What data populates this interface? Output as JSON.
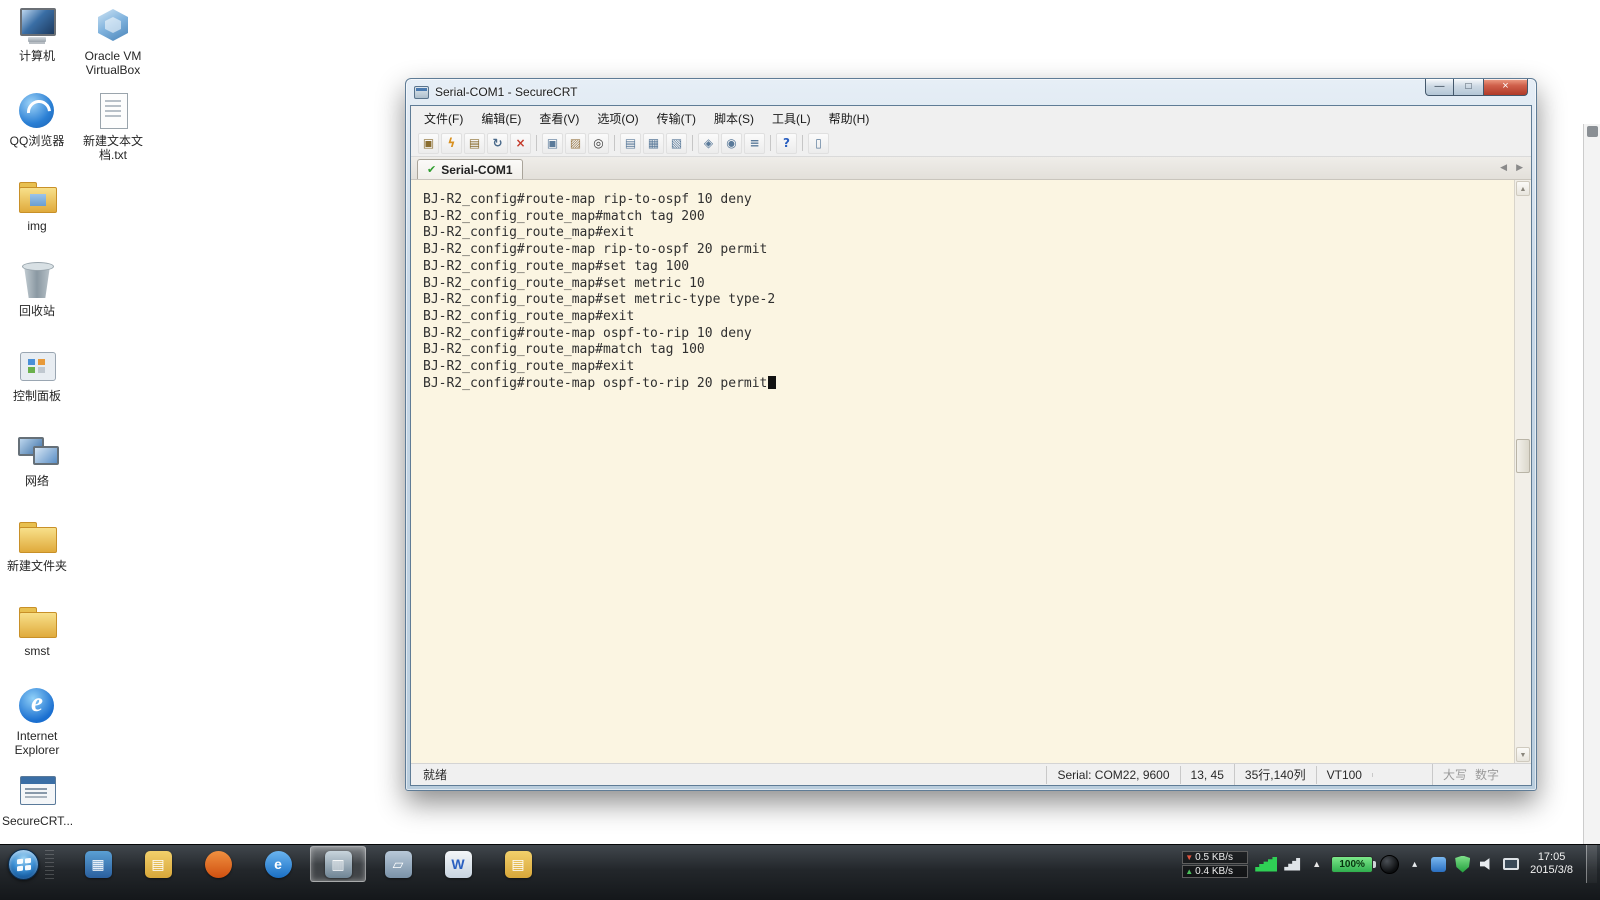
{
  "desktop": {
    "icons_col1": [
      {
        "name": "my-computer",
        "label": "计算机",
        "type": "computer"
      },
      {
        "name": "qq-browser",
        "label": "QQ浏览器",
        "type": "qq"
      },
      {
        "name": "img-folder",
        "label": "img",
        "type": "folder-img"
      },
      {
        "name": "recycle-bin",
        "label": "回收站",
        "type": "recycle"
      },
      {
        "name": "control-panel",
        "label": "控制面板",
        "type": "panel"
      },
      {
        "name": "network",
        "label": "网络",
        "type": "network"
      },
      {
        "name": "new-folder",
        "label": "新建文件夹",
        "type": "folder"
      },
      {
        "name": "smst-folder",
        "label": "smst",
        "type": "folder"
      },
      {
        "name": "internet-explorer",
        "label": "Internet Explorer",
        "type": "ie"
      },
      {
        "name": "securecrt-shortcut",
        "label": "SecureCRT...",
        "type": "crt"
      }
    ],
    "icons_col2": [
      {
        "name": "virtualbox",
        "label": "Oracle VM VirtualBox",
        "type": "vbox"
      },
      {
        "name": "new-text-file",
        "label": "新建文本文档.txt",
        "type": "txt"
      }
    ]
  },
  "window": {
    "title": "Serial-COM1 - SecureCRT",
    "controls": {
      "minimize": "—",
      "maximize": "□",
      "close": "×"
    },
    "menu": [
      "文件(F)",
      "编辑(E)",
      "查看(V)",
      "选项(O)",
      "传输(T)",
      "脚本(S)",
      "工具(L)",
      "帮助(H)"
    ],
    "toolbar": [
      {
        "name": "connect-icon",
        "glyph": "▣",
        "color": "#8a6d2f"
      },
      {
        "name": "quick-connect-icon",
        "glyph": "ϟ",
        "color": "#d89020"
      },
      {
        "name": "connect-in-tab-icon",
        "glyph": "▤",
        "color": "#8a6d2f"
      },
      {
        "name": "reconnect-icon",
        "glyph": "↻",
        "color": "#4a6a8a"
      },
      {
        "name": "disconnect-icon",
        "glyph": "×",
        "color": "#c43a2a"
      },
      {
        "sep": true
      },
      {
        "name": "copy-icon",
        "glyph": "▣",
        "color": "#5a7a9a"
      },
      {
        "name": "paste-icon",
        "glyph": "▨",
        "color": "#9a7a4a"
      },
      {
        "name": "find-icon",
        "glyph": "◎",
        "color": "#3a3a3a"
      },
      {
        "sep": true
      },
      {
        "name": "log-session-icon",
        "glyph": "▤",
        "color": "#5a7a9a"
      },
      {
        "name": "print-icon",
        "glyph": "▦",
        "color": "#5a7a9a"
      },
      {
        "name": "print-preview-icon",
        "glyph": "▧",
        "color": "#5a7a9a"
      },
      {
        "sep": true
      },
      {
        "name": "session-options-icon",
        "glyph": "◈",
        "color": "#5a7a9a"
      },
      {
        "name": "global-options-icon",
        "glyph": "◉",
        "color": "#5a7a9a"
      },
      {
        "name": "keymap-icon",
        "glyph": "≡",
        "color": "#5a7a9a"
      },
      {
        "sep": true
      },
      {
        "name": "help-icon",
        "glyph": "?",
        "color": "#2a5fc0"
      },
      {
        "sep": true
      },
      {
        "name": "properties-icon",
        "glyph": "▯",
        "color": "#5a7a9a"
      }
    ],
    "tab": {
      "check": "✔",
      "label": "Serial-COM1"
    },
    "tab_nav": {
      "left": "◀",
      "right": "▶"
    },
    "terminal": {
      "lines": [
        "BJ-R2_config#route-map rip-to-ospf 10 deny",
        "BJ-R2_config_route_map#match tag 200",
        "BJ-R2_config_route_map#exit",
        "BJ-R2_config#route-map rip-to-ospf 20 permit",
        "BJ-R2_config_route_map#set tag 100",
        "BJ-R2_config_route_map#set metric 10",
        "BJ-R2_config_route_map#set metric-type type-2",
        "BJ-R2_config_route_map#exit",
        "BJ-R2_config#route-map ospf-to-rip 10 deny",
        "BJ-R2_config_route_map#match tag 100",
        "BJ-R2_config_route_map#exit",
        "BJ-R2_config#route-map ospf-to-rip 20 permit"
      ]
    },
    "scrollbar": {
      "up": "▲",
      "down": "▼"
    },
    "status": {
      "ready": "就绪",
      "serial": "Serial: COM22, 9600",
      "position": "13, 45",
      "dimensions": "35行,140列",
      "emulation": "VT100",
      "caps": "大写",
      "num": "数字"
    }
  },
  "colors": {
    "terminal_bg": "#fbf5e2",
    "taskbar_bg": "#1c2024",
    "accent_green_check": "#2f9e2f",
    "close_button_red": "#b03a28"
  },
  "taskbar": {
    "apps": [
      {
        "name": "remote-desktop-app",
        "glyph": "▦",
        "color1": "#5a9fd4",
        "color2": "#2a5f9e"
      },
      {
        "name": "libraries-folder",
        "glyph": "▤",
        "color1": "#f2d06b",
        "color2": "#d8a73a"
      },
      {
        "name": "firefox-browser",
        "glyph": "",
        "color1": "#f09040",
        "color2": "#d05010",
        "round": true
      },
      {
        "name": "ie-browser",
        "glyph": "e",
        "color1": "#6ab4f0",
        "color2": "#1a6fc4",
        "round": true
      },
      {
        "name": "securecrt-app",
        "glyph": "▥",
        "color1": "#c8d4dc",
        "color2": "#6f8494",
        "active": true
      },
      {
        "name": "notepad-app",
        "glyph": "▱",
        "color1": "#b8c8d8",
        "color2": "#7a92a8"
      },
      {
        "name": "word-app",
        "glyph": "W",
        "color1": "#f4f6f8",
        "color2": "#c8d4e0",
        "glyphColor": "#2a5fc0"
      },
      {
        "name": "explorer-folder",
        "glyph": "▤",
        "color1": "#f2d06b",
        "color2": "#d8a73a"
      }
    ],
    "tray": {
      "down_arrow": "▼",
      "down_speed": "0.5 KB/s",
      "up_arrow": "▲",
      "up_speed": "0.4 KB/s",
      "hidden_icons": "▲",
      "battery": "100%",
      "time": "17:05",
      "date": "2015/3/8"
    }
  }
}
